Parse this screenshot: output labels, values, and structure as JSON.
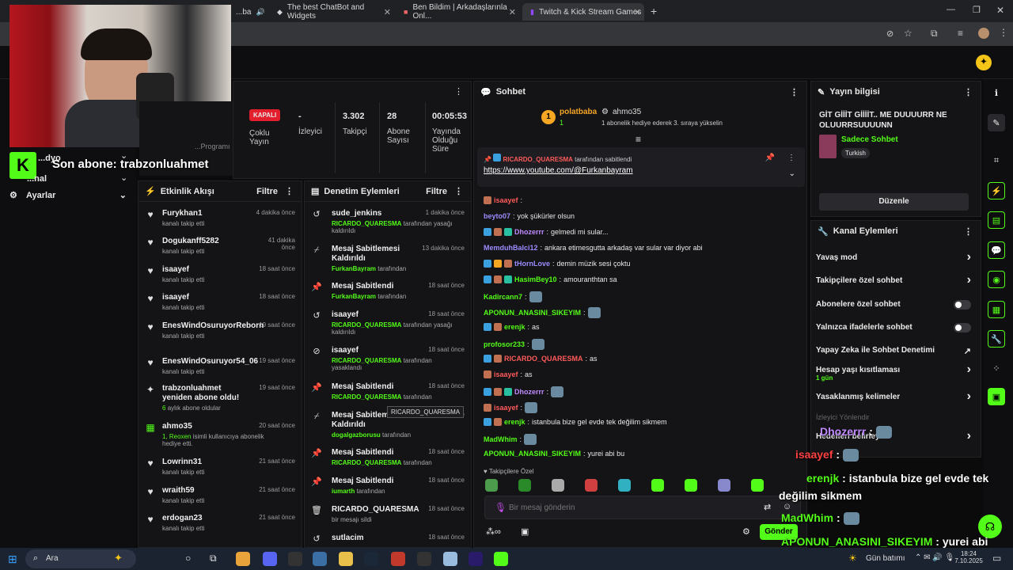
{
  "browser": {
    "tabs": [
      {
        "label": "...ba"
      },
      {
        "label": "The best ChatBot and Widgets"
      },
      {
        "label": "Ben Bildim | Arkadaşlarınla Onl..."
      },
      {
        "label": "Twitch & Kick Stream Games"
      }
    ]
  },
  "stream_overlay": {
    "sub_text": "Son abone: trabzonluahmet",
    "partial_menu": [
      "...dyo",
      "...nal"
    ],
    "settings_label": "Ayarlar",
    "partial_prog": "...Programı"
  },
  "stats": {
    "status": "KAPALI",
    "viewers_value": "-",
    "viewers_label": "Çoklu Yayın",
    "izleyici": "İzleyici",
    "followers_value": "3.302",
    "followers_label": "Takipçi",
    "subs_value": "28",
    "subs_label": "Abone Sayısı",
    "uptime_value": "00:05:53",
    "uptime_label": "Yayında Olduğu Süre"
  },
  "activity": {
    "title": "Etkinlik Akışı",
    "filter": "Filtre",
    "items": [
      {
        "name": "Furykhan1",
        "sub": "kanalı takip etti",
        "time": "4 dakika önce"
      },
      {
        "name": "Dogukanff5282",
        "sub": "kanalı takip etti",
        "time": "41 dakika önce"
      },
      {
        "name": "isaayef",
        "sub": "kanalı takip etti",
        "time": "18 saat önce"
      },
      {
        "name": "isaayef",
        "sub": "kanalı takip etti",
        "time": "18 saat önce"
      },
      {
        "name": "EnesWindOsuruyorReborn",
        "sub": "kanalı takip etti",
        "time": "19 saat önce"
      },
      {
        "name": "EnesWindOsuruyor54_06",
        "sub": "kanalı takip etti",
        "time": "19 saat önce"
      },
      {
        "name": "trabzonluahmet yeniden abone oldu!",
        "sub_green": "6",
        "sub": "aylık abone oldular",
        "time": "19 saat önce"
      },
      {
        "name": "ahmo35",
        "sub_green": "1, Reoxen",
        "sub": "isimli kullanıcıya abonelik hediye etti.",
        "time": "20 saat önce"
      },
      {
        "name": "Lowrinn31",
        "sub": "kanalı takip etti",
        "time": "21 saat önce"
      },
      {
        "name": "wraith59",
        "sub": "kanalı takip etti",
        "time": "21 saat önce"
      },
      {
        "name": "erdogan23",
        "sub": "kanalı takip etti",
        "time": "21 saat önce"
      }
    ]
  },
  "moderation": {
    "title": "Denetim Eylemleri",
    "filter": "Filtre",
    "tooltip": "RICARDO_QUARESMA",
    "items": [
      {
        "title": "sude_jenkins",
        "who": "RICARDO_QUARESMA",
        "rest": "tarafından yasağı kaldırıldı",
        "time": "1 dakika önce",
        "icon": "undo-icon"
      },
      {
        "title": "Mesaj Sabitlemesi Kaldırıldı",
        "who": "FurkanBayram",
        "rest": "tarafından",
        "time": "13 dakika önce",
        "icon": "unpin-icon"
      },
      {
        "title": "Mesaj Sabitlendi",
        "who": "FurkanBayram",
        "rest": "tarafından",
        "time": "18 saat önce",
        "icon": "pin-icon"
      },
      {
        "title": "isaayef",
        "who": "RICARDO_QUARESMA",
        "rest": "tarafından yasağı kaldırıldı",
        "time": "18 saat önce",
        "icon": "undo-icon"
      },
      {
        "title": "isaayef",
        "who": "RICARDO_QUARESMA",
        "rest": "tarafından yasaklandı",
        "time": "18 saat önce",
        "icon": "ban-icon"
      },
      {
        "title": "Mesaj Sabitlendi",
        "who": "RICARDO_QUARESMA",
        "rest": "tarafından",
        "time": "18 saat önce",
        "icon": "pin-icon"
      },
      {
        "title": "Mesaj Sabitlemesi Kaldırıldı",
        "who": "dogalgazborusu",
        "rest": "tarafından",
        "time": "18 saat önce",
        "icon": "unpin-icon"
      },
      {
        "title": "Mesaj Sabitlendi",
        "who": "RICARDO_QUARESMA",
        "rest": "tarafından",
        "time": "18 saat önce",
        "icon": "pin-icon"
      },
      {
        "title": "Mesaj Sabitlendi",
        "who": "iumarth",
        "rest": "tarafından",
        "time": "18 saat önce",
        "icon": "pin-icon"
      },
      {
        "title": "RICARDO_QUARESMA",
        "who": "",
        "rest": "bir mesajı sildi",
        "time": "18 saat önce",
        "icon": "trash-icon"
      },
      {
        "title": "sutlacim",
        "who": "",
        "rest": "",
        "time": "18 saat önce",
        "icon": "undo-icon"
      }
    ]
  },
  "chat": {
    "title": "Sohbet",
    "leader": {
      "rank": "1",
      "name": "polatbaba",
      "count": "1"
    },
    "gifter": {
      "name": "ahmo35",
      "text": "1 abonelik hediye ederek 3. sıraya yükselin"
    },
    "pinned": {
      "user": "RICARDO_QUARESMA",
      "by": "tarafından sabitlendi",
      "link": "https://www.youtube.com/@Furkanbayram"
    },
    "messages": [
      {
        "user": "isaayef",
        "text": "",
        "color": "#ff5a5a"
      },
      {
        "user": "beyto07",
        "text": "yok şükürler olsun",
        "color": "#9b8cff"
      },
      {
        "user": "Dhozerrr",
        "text": "gelmedi mi sular...",
        "color": "#c08bff"
      },
      {
        "user": "MemduhBalci12",
        "text": "ankara etimesgutta arkadaş var sular var diyor abi",
        "color": "#9b8cff"
      },
      {
        "user": "tHornLove",
        "text": "demin müzik sesi çoktu",
        "color": "#9b8cff"
      },
      {
        "user": "HasimBey10",
        "text": "amouranthtan sa",
        "color": "#53fc18"
      },
      {
        "user": "Kadircann7",
        "text": "",
        "color": "#53fc18"
      },
      {
        "user": "APONUN_ANASINI_SIKEYIM",
        "text": "",
        "color": "#53fc18"
      },
      {
        "user": "erenjk",
        "text": "as",
        "color": "#53fc18"
      },
      {
        "user": "profosor233",
        "text": "",
        "color": "#53fc18"
      },
      {
        "user": "RICARDO_QUARESMA",
        "text": "as",
        "color": "#ff5a5a"
      },
      {
        "user": "isaayef",
        "text": "as",
        "color": "#ff5a5a"
      },
      {
        "user": "Dhozerrr",
        "text": "",
        "color": "#c08bff"
      },
      {
        "user": "isaayef",
        "text": "",
        "color": "#ff5a5a"
      },
      {
        "user": "erenjk",
        "text": "istanbula bize gel evde tek değilim sikmem",
        "color": "#53fc18"
      },
      {
        "user": "MadWhim",
        "text": "",
        "color": "#53fc18"
      },
      {
        "user": "APONUN_ANASINI_SIKEYIM",
        "text": "yurei abi bu",
        "color": "#53fc18"
      }
    ],
    "followers_only": "Takipçilere Özel",
    "input_placeholder": "Bir mesaj gönderin",
    "send": "Gönder"
  },
  "stream_info": {
    "title": "Yayın bilgisi",
    "stream_title": "GİT GİİİT GİİİİT.. ME DUUUURR NE OLUURRSUUUUNN",
    "category": "Sadece Sohbet",
    "tag": "Turkish",
    "edit": "Düzenle"
  },
  "channel_actions": {
    "title": "Kanal Eylemleri",
    "items": [
      {
        "label": "Yavaş mod",
        "type": "chevron"
      },
      {
        "label": "Takipçilere özel sohbet",
        "type": "chevron"
      },
      {
        "label": "Abonelere özel sohbet",
        "type": "toggle"
      },
      {
        "label": "Yalnızca ifadelerle sohbet",
        "type": "toggle"
      },
      {
        "label": "Yapay Zeka ile Sohbet Denetimi",
        "type": "external"
      },
      {
        "label": "Hesap yaşı kısıtlaması",
        "sub": "1 gün",
        "type": "chevron"
      },
      {
        "label": "Yasaklanmış kelimeler",
        "type": "chevron"
      },
      {
        "label": "İzleyici Yönlendir",
        "type": "none"
      },
      {
        "label": "Hedefleri belirleyin",
        "type": "chevron"
      }
    ]
  },
  "chat_overlay": [
    {
      "user": "Dhozerrr",
      "text": "",
      "color": "#c08bff"
    },
    {
      "user": "isaayef",
      "text": "",
      "color": "#ff4040"
    },
    {
      "user": "erenjk",
      "text": "istanbula bize gel evde tek",
      "color": "#53fc18"
    },
    {
      "user": "",
      "text": "değilim sikmem",
      "color": "#fff"
    },
    {
      "user": "MadWhim",
      "text": "",
      "color": "#53fc18"
    },
    {
      "user": "APONUN_ANASINI_SIKEYIM",
      "text": "yurei abi",
      "color": "#53fc18"
    },
    {
      "user": "",
      "text": "bu",
      "color": "#fff"
    }
  ],
  "taskbar": {
    "search": "Ara",
    "weather": "Gün batımı",
    "time": "18:24",
    "date": "7.10.2025"
  }
}
